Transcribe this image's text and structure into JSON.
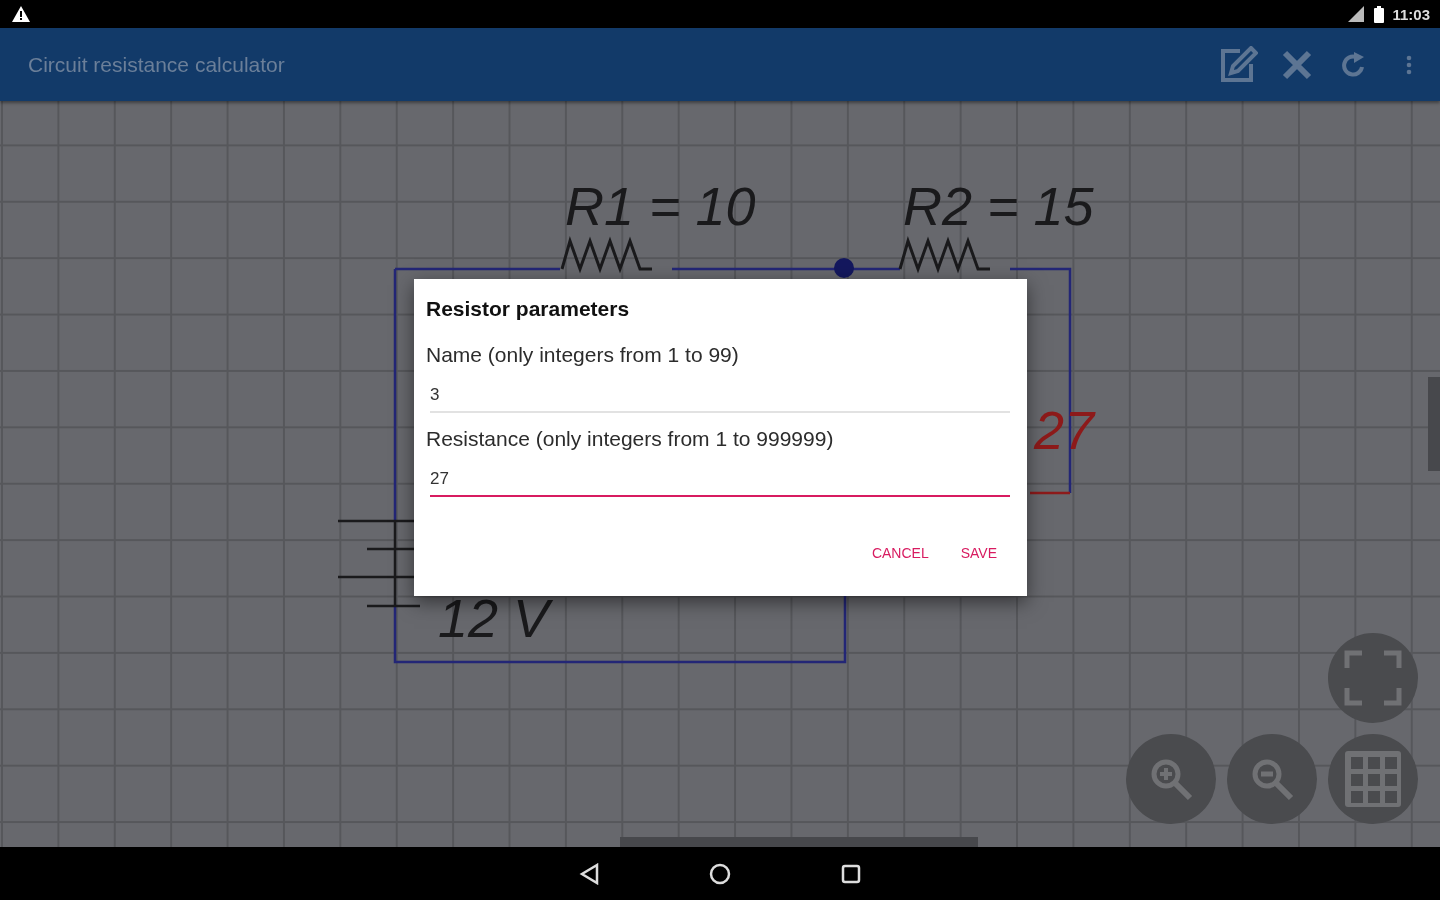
{
  "status_bar": {
    "time": "11:03"
  },
  "app_bar": {
    "title": "Circuit resistance calculator"
  },
  "circuit": {
    "labels": [
      {
        "text": "R1 = 10",
        "kind": "resistor"
      },
      {
        "text": "R2 = 15",
        "kind": "resistor"
      },
      {
        "text": "27",
        "kind": "selected"
      },
      {
        "text": "12 V",
        "kind": "battery"
      }
    ]
  },
  "dialog": {
    "title": "Resistor parameters",
    "fields": [
      {
        "label": "Name (only integers from 1 to 99)",
        "value": "3",
        "focused": false
      },
      {
        "label": "Resistance (only integers from 1 to 999999)",
        "value": "27",
        "focused": true
      }
    ],
    "buttons": [
      "CANCEL",
      "SAVE"
    ]
  }
}
